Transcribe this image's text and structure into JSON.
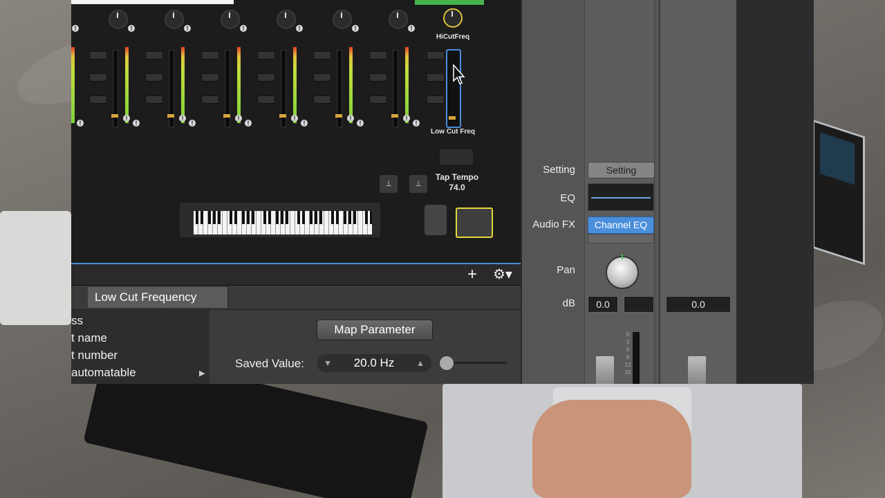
{
  "mixer": {
    "knob_hi_label": "HiCutFreq",
    "low_cut_label": "Low Cut Freq",
    "tap_tempo_label": "Tap Tempo",
    "tap_tempo_value": "74.0",
    "excl_mark": "!"
  },
  "channel_strip": {
    "setting_label": "Setting",
    "setting_button": "Setting",
    "eq_label": "EQ",
    "audio_fx_label": "Audio FX",
    "audio_fx_plugin": "Channel EQ",
    "pan_label": "Pan",
    "db_label": "dB",
    "db_value_1": "0.0",
    "db_value_2": "0.0",
    "meter_scale": [
      "0",
      "3",
      "6",
      "9",
      "12",
      "15"
    ]
  },
  "smart_controls": {
    "add_icon": "+",
    "gear_icon": "⚙▾",
    "tab_label": "Low Cut Frequency",
    "list_items": [
      "ss",
      "t name",
      "t number",
      "automatable"
    ],
    "map_button": "Map Parameter",
    "saved_value_label": "Saved Value:",
    "saved_value": "20.0 Hz",
    "saved_value_down": "▼",
    "saved_value_up": "▲",
    "submenu_arrow": "▶"
  }
}
